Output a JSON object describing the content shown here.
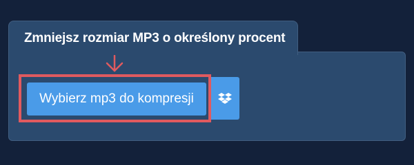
{
  "header": {
    "title": "Zmniejsz rozmiar MP3 o określony procent"
  },
  "uploader": {
    "select_button_label": "Wybierz mp3 do kompresji",
    "dropbox_icon": "dropbox-icon"
  },
  "colors": {
    "page_background": "#13213a",
    "panel_background": "#2b4a6e",
    "button_blue": "#4a9be8",
    "highlight_red": "#e05a5f"
  }
}
